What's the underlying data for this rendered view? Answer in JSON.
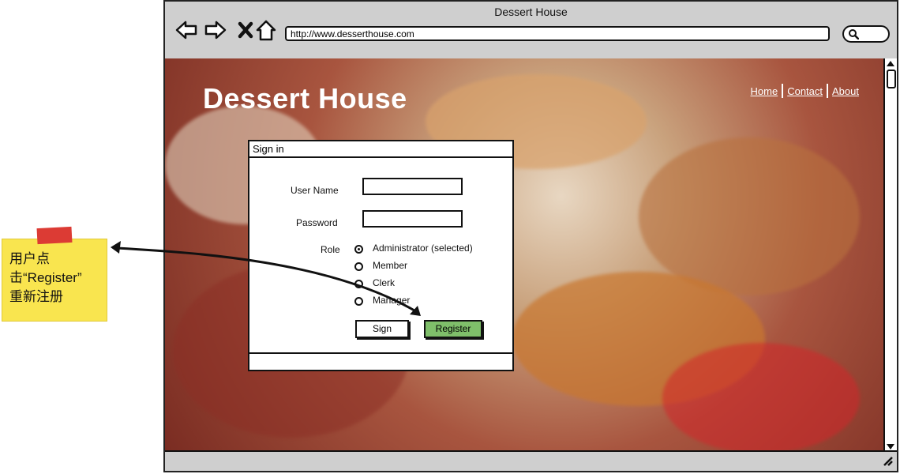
{
  "browser": {
    "title": "Dessert House",
    "url": "http://www.desserthouse.com"
  },
  "site": {
    "title": "Dessert House",
    "nav": [
      "Home",
      "Contact",
      "About"
    ]
  },
  "signin": {
    "title": "Sign in",
    "username_label": "User Name",
    "username_value": "",
    "password_label": "Password",
    "password_value": "",
    "role_label": "Role",
    "roles": [
      "Administrator (selected)",
      "Member",
      "Clerk",
      "Manager"
    ],
    "selected_role": "Administrator (selected)",
    "sign_button": "Sign",
    "register_button": "Register"
  },
  "annotation": {
    "lines": [
      "用户点",
      "击“Register”",
      "重新注册"
    ]
  },
  "colors": {
    "register_button": "#7fbf6a",
    "note_bg": "#f9e54f",
    "tape": "#dc3b34"
  }
}
